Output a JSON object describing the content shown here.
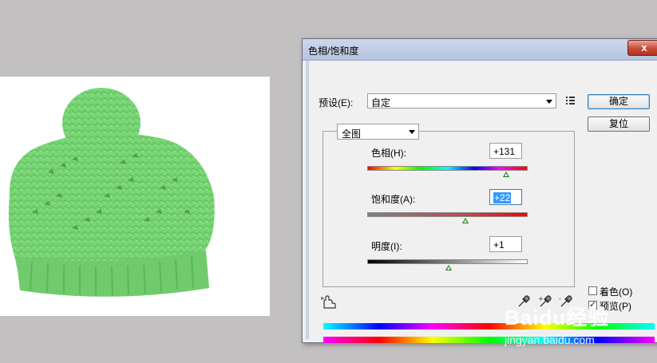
{
  "dialog": {
    "title": "色相/饱和度",
    "close_label": "x",
    "preset_label": "预设(E):",
    "preset_value": "自定",
    "ok_label": "确定",
    "reset_label": "复位",
    "channel_value": "全图"
  },
  "adjust": {
    "hue_label": "色相(H):",
    "hue_value": "+131",
    "hue_level": 131,
    "saturation_label": "饱和度(A):",
    "saturation_value": "+22",
    "saturation_level": 22,
    "lightness_label": "明度(I):",
    "lightness_value": "+1",
    "lightness_level": 1
  },
  "options": {
    "colorize_label": "着色(O)",
    "colorize_checked": false,
    "preview_label": "预览(P)",
    "preview_checked": true
  },
  "icons": [
    "preset-menu-icon",
    "hand-adjust-icon",
    "eyedropper-icon",
    "eyedropper-plus-icon",
    "eyedropper-minus-icon"
  ],
  "watermark": {
    "logo_text": "Baidu经验",
    "url": "jingyan.baidu.com"
  },
  "colors": {
    "hat_green": "#7dd67a",
    "thumb_green": "#1c7a1c",
    "title_bar": "#c2cde4"
  }
}
